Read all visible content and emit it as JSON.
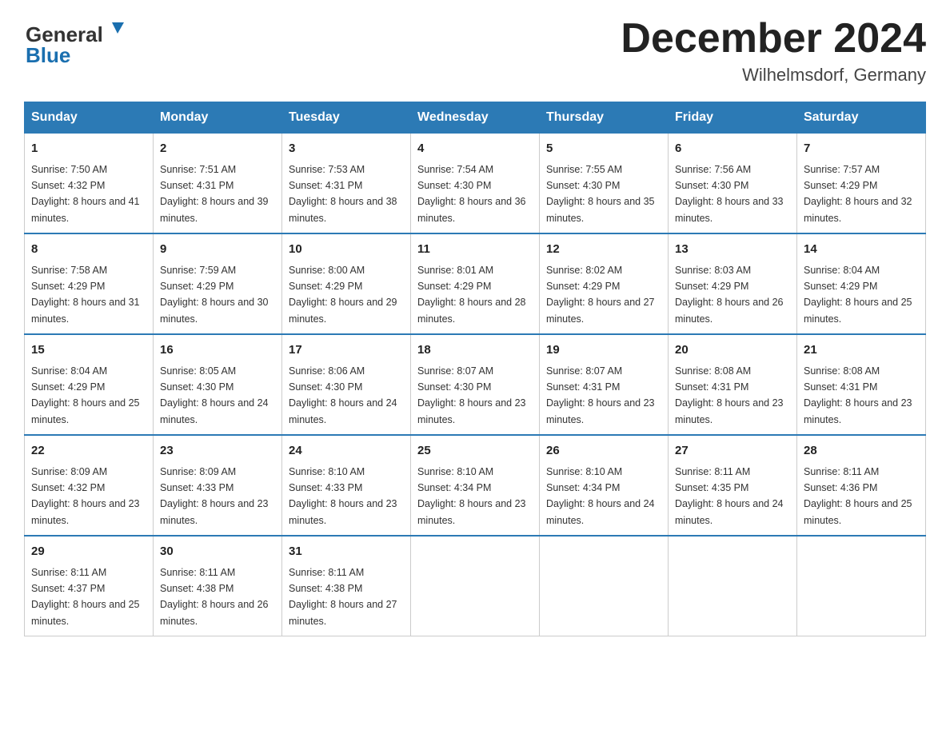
{
  "header": {
    "logo_general": "General",
    "logo_blue": "Blue",
    "month_title": "December 2024",
    "location": "Wilhelmsdorf, Germany"
  },
  "days_of_week": [
    "Sunday",
    "Monday",
    "Tuesday",
    "Wednesday",
    "Thursday",
    "Friday",
    "Saturday"
  ],
  "weeks": [
    [
      {
        "day": "1",
        "sunrise": "7:50 AM",
        "sunset": "4:32 PM",
        "daylight": "8 hours and 41 minutes."
      },
      {
        "day": "2",
        "sunrise": "7:51 AM",
        "sunset": "4:31 PM",
        "daylight": "8 hours and 39 minutes."
      },
      {
        "day": "3",
        "sunrise": "7:53 AM",
        "sunset": "4:31 PM",
        "daylight": "8 hours and 38 minutes."
      },
      {
        "day": "4",
        "sunrise": "7:54 AM",
        "sunset": "4:30 PM",
        "daylight": "8 hours and 36 minutes."
      },
      {
        "day": "5",
        "sunrise": "7:55 AM",
        "sunset": "4:30 PM",
        "daylight": "8 hours and 35 minutes."
      },
      {
        "day": "6",
        "sunrise": "7:56 AM",
        "sunset": "4:30 PM",
        "daylight": "8 hours and 33 minutes."
      },
      {
        "day": "7",
        "sunrise": "7:57 AM",
        "sunset": "4:29 PM",
        "daylight": "8 hours and 32 minutes."
      }
    ],
    [
      {
        "day": "8",
        "sunrise": "7:58 AM",
        "sunset": "4:29 PM",
        "daylight": "8 hours and 31 minutes."
      },
      {
        "day": "9",
        "sunrise": "7:59 AM",
        "sunset": "4:29 PM",
        "daylight": "8 hours and 30 minutes."
      },
      {
        "day": "10",
        "sunrise": "8:00 AM",
        "sunset": "4:29 PM",
        "daylight": "8 hours and 29 minutes."
      },
      {
        "day": "11",
        "sunrise": "8:01 AM",
        "sunset": "4:29 PM",
        "daylight": "8 hours and 28 minutes."
      },
      {
        "day": "12",
        "sunrise": "8:02 AM",
        "sunset": "4:29 PM",
        "daylight": "8 hours and 27 minutes."
      },
      {
        "day": "13",
        "sunrise": "8:03 AM",
        "sunset": "4:29 PM",
        "daylight": "8 hours and 26 minutes."
      },
      {
        "day": "14",
        "sunrise": "8:04 AM",
        "sunset": "4:29 PM",
        "daylight": "8 hours and 25 minutes."
      }
    ],
    [
      {
        "day": "15",
        "sunrise": "8:04 AM",
        "sunset": "4:29 PM",
        "daylight": "8 hours and 25 minutes."
      },
      {
        "day": "16",
        "sunrise": "8:05 AM",
        "sunset": "4:30 PM",
        "daylight": "8 hours and 24 minutes."
      },
      {
        "day": "17",
        "sunrise": "8:06 AM",
        "sunset": "4:30 PM",
        "daylight": "8 hours and 24 minutes."
      },
      {
        "day": "18",
        "sunrise": "8:07 AM",
        "sunset": "4:30 PM",
        "daylight": "8 hours and 23 minutes."
      },
      {
        "day": "19",
        "sunrise": "8:07 AM",
        "sunset": "4:31 PM",
        "daylight": "8 hours and 23 minutes."
      },
      {
        "day": "20",
        "sunrise": "8:08 AM",
        "sunset": "4:31 PM",
        "daylight": "8 hours and 23 minutes."
      },
      {
        "day": "21",
        "sunrise": "8:08 AM",
        "sunset": "4:31 PM",
        "daylight": "8 hours and 23 minutes."
      }
    ],
    [
      {
        "day": "22",
        "sunrise": "8:09 AM",
        "sunset": "4:32 PM",
        "daylight": "8 hours and 23 minutes."
      },
      {
        "day": "23",
        "sunrise": "8:09 AM",
        "sunset": "4:33 PM",
        "daylight": "8 hours and 23 minutes."
      },
      {
        "day": "24",
        "sunrise": "8:10 AM",
        "sunset": "4:33 PM",
        "daylight": "8 hours and 23 minutes."
      },
      {
        "day": "25",
        "sunrise": "8:10 AM",
        "sunset": "4:34 PM",
        "daylight": "8 hours and 23 minutes."
      },
      {
        "day": "26",
        "sunrise": "8:10 AM",
        "sunset": "4:34 PM",
        "daylight": "8 hours and 24 minutes."
      },
      {
        "day": "27",
        "sunrise": "8:11 AM",
        "sunset": "4:35 PM",
        "daylight": "8 hours and 24 minutes."
      },
      {
        "day": "28",
        "sunrise": "8:11 AM",
        "sunset": "4:36 PM",
        "daylight": "8 hours and 25 minutes."
      }
    ],
    [
      {
        "day": "29",
        "sunrise": "8:11 AM",
        "sunset": "4:37 PM",
        "daylight": "8 hours and 25 minutes."
      },
      {
        "day": "30",
        "sunrise": "8:11 AM",
        "sunset": "4:38 PM",
        "daylight": "8 hours and 26 minutes."
      },
      {
        "day": "31",
        "sunrise": "8:11 AM",
        "sunset": "4:38 PM",
        "daylight": "8 hours and 27 minutes."
      },
      null,
      null,
      null,
      null
    ]
  ],
  "labels": {
    "sunrise": "Sunrise:",
    "sunset": "Sunset:",
    "daylight": "Daylight:"
  }
}
